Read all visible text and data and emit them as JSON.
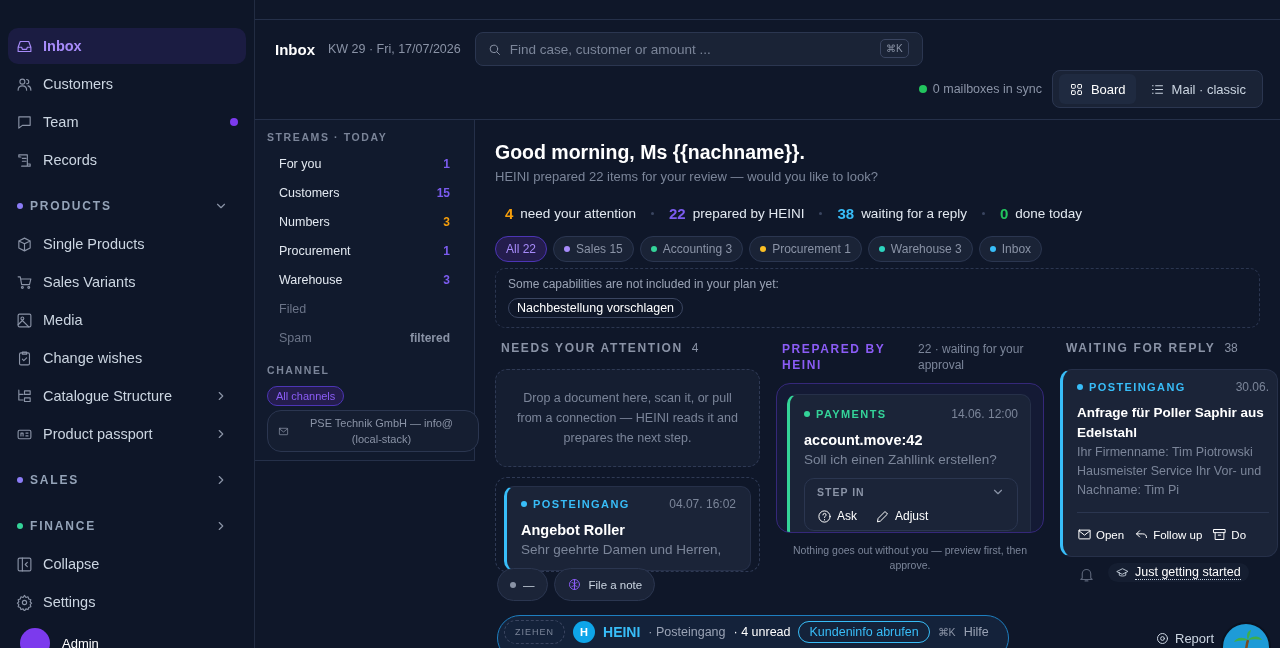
{
  "sidebar": {
    "items": [
      {
        "kind": "link",
        "label": "Inbox",
        "selected": true,
        "unread": false,
        "submenu": false
      },
      {
        "kind": "link",
        "label": "Customers",
        "selected": false,
        "unread": false,
        "submenu": false
      },
      {
        "kind": "link",
        "label": "Team",
        "selected": false,
        "unread": true,
        "submenu": false
      },
      {
        "kind": "link",
        "label": "Records",
        "selected": false,
        "unread": false,
        "submenu": false
      },
      {
        "kind": "section",
        "label": "PRODUCTS",
        "color": "#8b7cf6",
        "expanded": true
      },
      {
        "kind": "link",
        "label": "Single Products",
        "selected": false,
        "unread": false,
        "submenu": false
      },
      {
        "kind": "link",
        "label": "Sales Variants",
        "selected": false,
        "unread": false,
        "submenu": false
      },
      {
        "kind": "link",
        "label": "Media",
        "selected": false,
        "unread": false,
        "submenu": false
      },
      {
        "kind": "link",
        "label": "Change wishes",
        "selected": false,
        "unread": false,
        "submenu": false
      },
      {
        "kind": "link",
        "label": "Catalogue Structure",
        "selected": false,
        "unread": false,
        "submenu": true
      },
      {
        "kind": "link",
        "label": "Product passport",
        "selected": false,
        "unread": false,
        "submenu": true
      },
      {
        "kind": "section",
        "label": "SALES",
        "color": "#8b7cf6",
        "expanded": false
      },
      {
        "kind": "section",
        "label": "FINANCE",
        "color": "#34d399",
        "expanded": false
      }
    ],
    "footer": [
      {
        "label": "Collapse"
      },
      {
        "label": "Settings"
      }
    ],
    "user": {
      "name": "Admin"
    }
  },
  "header": {
    "title": "Inbox",
    "date": "KW 29 · Fri, 17/07/2026",
    "search": {
      "placeholder": "Find case, customer or amount ...",
      "shortcut": "⌘K"
    },
    "sync": {
      "label": "0 mailboxes in sync",
      "color": "#22c55e"
    },
    "views": [
      {
        "label": "Board",
        "selected": true
      },
      {
        "label": "Mail · classic",
        "selected": false
      }
    ]
  },
  "streams": {
    "title": "STREAMS · TODAY",
    "items": [
      {
        "label": "For you",
        "count": "1",
        "color": "#7c5cf0",
        "muted": false
      },
      {
        "label": "Customers",
        "count": "15",
        "color": "#7c5cf0",
        "muted": false
      },
      {
        "label": "Numbers",
        "count": "3",
        "color": "#f59e0b",
        "muted": false
      },
      {
        "label": "Procurement",
        "count": "1",
        "color": "#7c5cf0",
        "muted": false
      },
      {
        "label": "Warehouse",
        "count": "3",
        "color": "#7c5cf0",
        "muted": false
      },
      {
        "label": "Filed",
        "muted": true
      },
      {
        "label": "Spam",
        "count": "filtered",
        "color": "#8a93a6",
        "muted": true
      }
    ],
    "channel_title": "CHANNEL",
    "channels": [
      {
        "label": "All channels",
        "selected": true
      },
      {
        "label": "PSE Technik GmbH — info@ (local-stack)",
        "selected": false
      }
    ]
  },
  "greeting": {
    "title": "Good morning, Ms {{nachname}}.",
    "subtitle": "HEINI prepared 22 items for your review — would you like to look?"
  },
  "stats": [
    {
      "value": "4",
      "label": "need your attention",
      "color": "#f59e0b"
    },
    {
      "value": "22",
      "label": "prepared by HEINI",
      "color": "#7c5cf0"
    },
    {
      "value": "38",
      "label": "waiting for a reply",
      "color": "#38bdf8"
    },
    {
      "value": "0",
      "label": "done today",
      "color": "#22c55e"
    }
  ],
  "filters": [
    {
      "label": "All 22",
      "selected": true
    },
    {
      "label": "Sales 15",
      "color": "#a78bfa",
      "selected": false
    },
    {
      "label": "Accounting 3",
      "color": "#34d399",
      "selected": false
    },
    {
      "label": "Procurement 1",
      "color": "#fbbf24",
      "selected": false
    },
    {
      "label": "Warehouse 3",
      "color": "#2dd4bf",
      "selected": false
    },
    {
      "label": "Inbox",
      "color": "#38bdf8",
      "selected": false
    }
  ],
  "plan": {
    "text": "Some capabilities are not included in your plan yet:",
    "features": [
      "Nachbestellung vorschlagen"
    ]
  },
  "columns": [
    {
      "kind": "attention",
      "title": "NEEDS YOUR ATTENTION",
      "count": "4",
      "dropzone": "Drop a document here, scan it, or pull from a connection — HEINI reads it and prepares the next step.",
      "cards": [
        {
          "tag": {
            "label": "POSTEINGANG",
            "color": "#38bdf8"
          },
          "time": "04.07. 16:02",
          "title": "Angebot Roller",
          "body": "Sehr geehrte Damen und Herren,"
        }
      ]
    },
    {
      "kind": "prepared",
      "title": "PREPARED BY HEINI",
      "meta": "22 · waiting for your approval",
      "cards": [
        {
          "tag": {
            "label": "PAYMENTS",
            "color": "#34d399"
          },
          "time": "14.06. 12:00",
          "title": "account.move:42",
          "body": "Soll ich einen Zahllink erstellen?",
          "step_in": {
            "label": "STEP IN",
            "actions": [
              "Ask",
              "Adjust"
            ]
          }
        }
      ],
      "note": "Nothing goes out without you — preview first, then approve."
    },
    {
      "kind": "waiting",
      "title": "WAITING FOR REPLY",
      "count": "38",
      "cards": [
        {
          "tag": {
            "label": "POSTEINGANG",
            "color": "#38bdf8"
          },
          "time": "30.06.",
          "title": "Anfrage für Poller Saphir aus Edelstahl",
          "body": "Ihr Firmenname: Tim Piotrowski Hausmeister Service Ihr Vor- und Nachname: Tim Pi",
          "actions": [
            "Open",
            "Follow up",
            "Do"
          ]
        }
      ]
    }
  ],
  "quick_actions": [
    {
      "kind": "status",
      "label": "—"
    },
    {
      "kind": "note",
      "label": "File a note"
    }
  ],
  "onboarding": {
    "label": "Just getting started"
  },
  "assistant_bar": {
    "handle": "ZIEHEN",
    "avatar": "H",
    "name": "HEINI",
    "context": "· Posteingang",
    "unread": "· 4 unread",
    "action": "Kundeninfo abrufen",
    "shortcut": "⌘K",
    "help": "Hilfe"
  },
  "report": {
    "label": "Report"
  }
}
